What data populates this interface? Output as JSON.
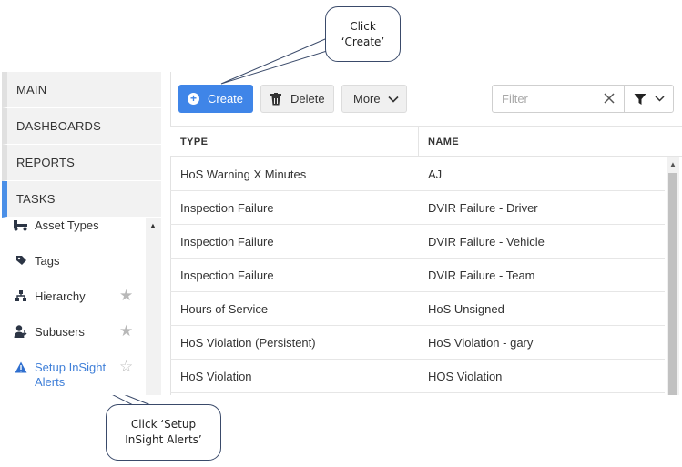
{
  "callouts": {
    "create": "Click ‘Create’",
    "insight": "Click ‘Setup InSight Alerts’"
  },
  "sidebar": {
    "nav": [
      {
        "label": "MAIN"
      },
      {
        "label": "DASHBOARDS"
      },
      {
        "label": "REPORTS"
      },
      {
        "label": "TASKS",
        "active": true
      }
    ],
    "items": [
      {
        "label": "Asset Types",
        "icon": "truck-icon"
      },
      {
        "label": "Tags",
        "icon": "tag-icon"
      },
      {
        "label": "Hierarchy",
        "icon": "hierarchy-icon",
        "starred": true
      },
      {
        "label": "Subusers",
        "icon": "user-icon",
        "starred": true
      },
      {
        "label": "Setup InSight Alerts",
        "icon": "warning-icon",
        "starred": false,
        "highlight": "#3f7fd8"
      }
    ]
  },
  "toolbar": {
    "create_label": "Create",
    "delete_label": "Delete",
    "more_label": "More",
    "filter_placeholder": "Filter"
  },
  "table": {
    "columns": [
      "TYPE",
      "NAME"
    ],
    "rows": [
      {
        "type": "HoS Warning X Minutes",
        "name": "AJ"
      },
      {
        "type": "Inspection Failure",
        "name": "DVIR Failure - Driver"
      },
      {
        "type": "Inspection Failure",
        "name": "DVIR Failure - Vehicle"
      },
      {
        "type": "Inspection Failure",
        "name": "DVIR Failure - Team"
      },
      {
        "type": "Hours of Service",
        "name": "HoS Unsigned"
      },
      {
        "type": "HoS Violation (Persistent)",
        "name": "HoS Violation - gary"
      },
      {
        "type": "HoS Violation",
        "name": "HOS Violation"
      }
    ]
  },
  "colors": {
    "accent": "#3f85e8",
    "active_nav": "#4a8fe7",
    "link": "#3f7fd8"
  }
}
